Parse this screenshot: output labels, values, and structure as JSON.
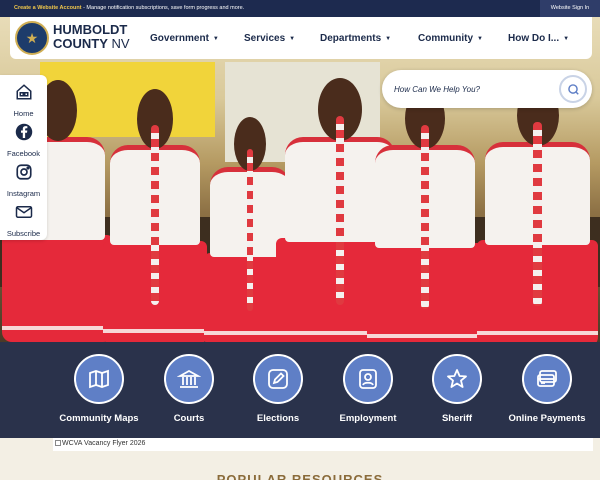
{
  "topbar": {
    "create_label": "Create a Website Account",
    "create_desc": " - Manage notification subscriptions, save form progress and more.",
    "signin_label": "Website Sign In"
  },
  "brand": {
    "line1": "HUMBOLDT",
    "line2_bold": "COUNTY",
    "line2_state": " NV"
  },
  "nav": {
    "items": [
      {
        "label": "Government"
      },
      {
        "label": "Services"
      },
      {
        "label": "Departments"
      },
      {
        "label": "Community"
      },
      {
        "label": "How Do I..."
      }
    ],
    "caret": "▼"
  },
  "search": {
    "placeholder": "How Can We Help You?"
  },
  "social": {
    "items": [
      {
        "label": "Home",
        "icon": "home-icon"
      },
      {
        "label": "Facebook",
        "icon": "facebook-icon"
      },
      {
        "label": "Instagram",
        "icon": "instagram-icon"
      },
      {
        "label": "Subscribe",
        "icon": "envelope-icon"
      }
    ]
  },
  "quick_links": [
    {
      "label": "Community Maps",
      "icon": "map-icon"
    },
    {
      "label": "Courts",
      "icon": "courthouse-icon"
    },
    {
      "label": "Elections",
      "icon": "pencil-icon"
    },
    {
      "label": "Employment",
      "icon": "badge-person-icon"
    },
    {
      "label": "Sheriff",
      "icon": "star-icon"
    },
    {
      "label": "Online Payments",
      "icon": "credit-card-icon"
    }
  ],
  "flyer": {
    "alt_text": "WCVA Vacancy Flyer 2026"
  },
  "popular": {
    "title": "POPULAR RESOURCES"
  },
  "colors": {
    "navy": "#1d2a4f",
    "accent_blue": "#5f7fc6",
    "gold": "#f2c84b"
  }
}
